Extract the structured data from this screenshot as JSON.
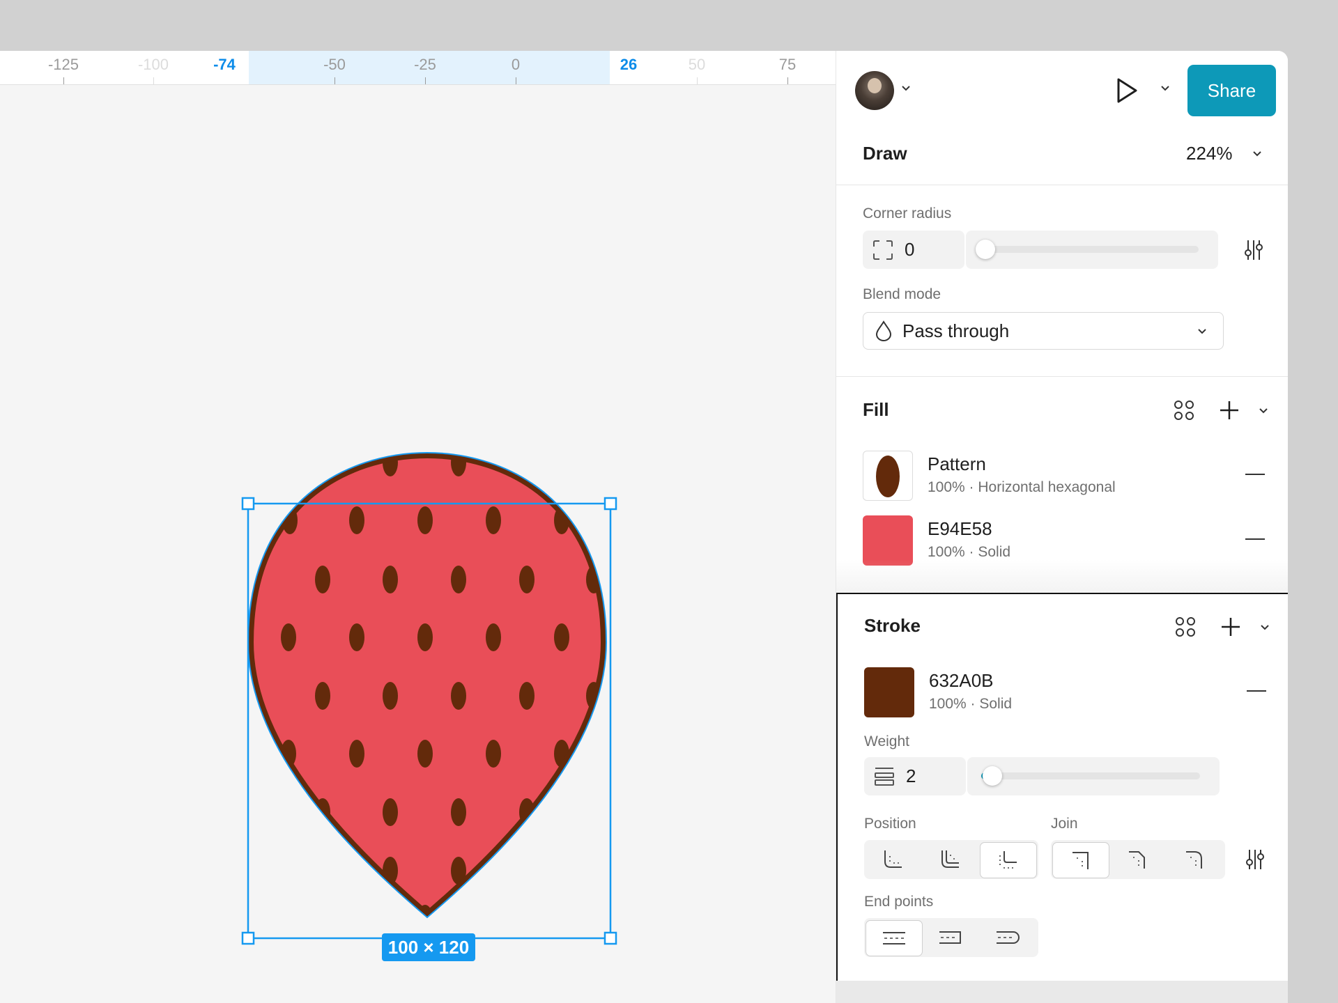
{
  "ruler": {
    "ticks": [
      "-125",
      "-100",
      "-74",
      "-50",
      "-25",
      "0",
      "26",
      "50",
      "75"
    ]
  },
  "canvas": {
    "selection_size": "100 × 120",
    "shape": {
      "fill_color": "#E94E58",
      "stroke_color": "#632A0B",
      "selection_color": "#1599F0"
    }
  },
  "header": {
    "share_label": "Share",
    "mode_label": "Draw",
    "zoom": "224%"
  },
  "appearance": {
    "corner_radius_label": "Corner radius",
    "corner_radius_value": "0",
    "blend_label": "Blend mode",
    "blend_value": "Pass through"
  },
  "fill": {
    "title": "Fill",
    "items": [
      {
        "name": "Pattern",
        "sub": "100% · Horizontal hexagonal"
      },
      {
        "name": "E94E58",
        "sub": "100% · Solid",
        "color": "#E94E58"
      }
    ]
  },
  "stroke": {
    "title": "Stroke",
    "color_name": "632A0B",
    "color_sub": "100% · Solid",
    "color": "#632A0B",
    "weight_label": "Weight",
    "weight_value": "2",
    "position_label": "Position",
    "join_label": "Join",
    "endpoints_label": "End points"
  },
  "icons": [
    "chevron-down-icon",
    "play-icon",
    "corner-radius-icon",
    "sliders-icon",
    "drop-icon",
    "styles-grid-icon",
    "plus-icon",
    "minus-icon",
    "stroke-weight-icon",
    "stroke-inside-icon",
    "stroke-center-icon",
    "stroke-outside-icon",
    "join-miter-icon",
    "join-bevel-icon",
    "join-round-icon",
    "cap-none-icon",
    "cap-square-icon",
    "cap-round-icon"
  ]
}
